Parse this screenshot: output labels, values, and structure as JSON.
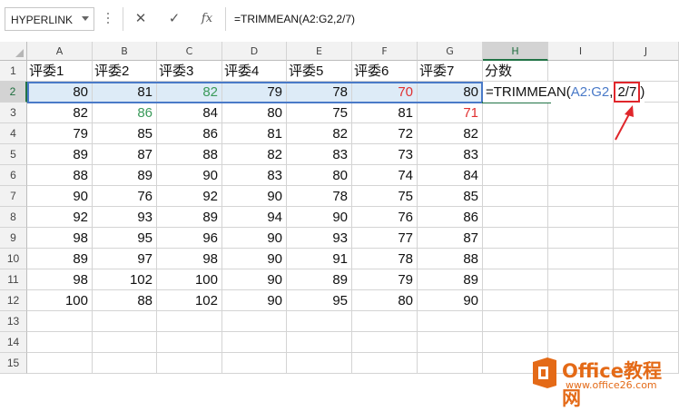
{
  "formula_bar": {
    "name_box": "HYPERLINK",
    "cancel_icon": "✕",
    "enter_icon": "✓",
    "fx_label": "fx",
    "formula": "=TRIMMEAN(A2:G2,2/7)"
  },
  "columns": [
    "A",
    "B",
    "C",
    "D",
    "E",
    "F",
    "G",
    "H",
    "I",
    "J"
  ],
  "rows": [
    "1",
    "2",
    "3",
    "4",
    "5",
    "6",
    "7",
    "8",
    "9",
    "10",
    "11",
    "12",
    "13",
    "14",
    "15"
  ],
  "headers": [
    "评委1",
    "评委2",
    "评委3",
    "评委4",
    "评委5",
    "评委6",
    "评委7",
    "分数"
  ],
  "scores": [
    [
      "80",
      "81",
      "82",
      "79",
      "78",
      "70",
      "80"
    ],
    [
      "82",
      "86",
      "84",
      "80",
      "75",
      "81",
      "71"
    ],
    [
      "79",
      "85",
      "86",
      "81",
      "82",
      "72",
      "82"
    ],
    [
      "89",
      "87",
      "88",
      "82",
      "83",
      "73",
      "83"
    ],
    [
      "88",
      "89",
      "90",
      "83",
      "80",
      "74",
      "84"
    ],
    [
      "90",
      "76",
      "92",
      "90",
      "78",
      "75",
      "85"
    ],
    [
      "92",
      "93",
      "89",
      "94",
      "90",
      "76",
      "86"
    ],
    [
      "98",
      "95",
      "96",
      "90",
      "93",
      "77",
      "87"
    ],
    [
      "89",
      "97",
      "98",
      "90",
      "91",
      "78",
      "88"
    ],
    [
      "98",
      "102",
      "100",
      "90",
      "89",
      "79",
      "89"
    ],
    [
      "100",
      "88",
      "102",
      "90",
      "95",
      "80",
      "90"
    ]
  ],
  "cell_colors": {
    "green": "#3a9a5a",
    "red": "#e03030",
    "selected_row_fill": "#ddebf7",
    "header_selected": "#217346"
  },
  "edit_cell": {
    "prefix": "=TRIMMEAN(",
    "ref": "A2:G2",
    "comma": ",",
    "highlighted_arg": "2/7",
    "suffix": ")"
  },
  "logo": {
    "name": "Office教程网",
    "url": "www.office26.com",
    "brand_color": "#e46a17"
  }
}
